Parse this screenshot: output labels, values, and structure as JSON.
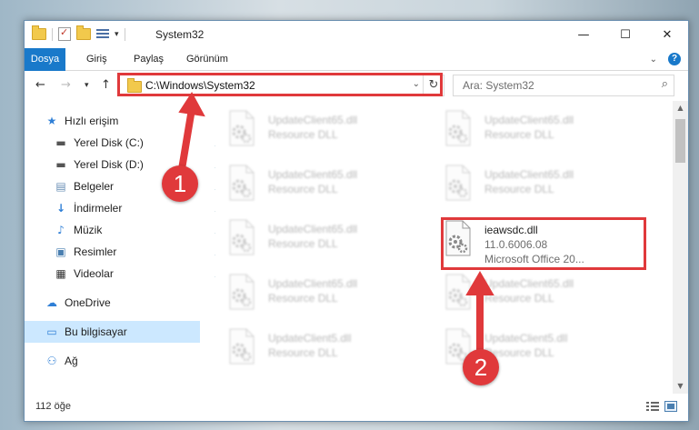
{
  "window": {
    "title": "System32",
    "controls": {
      "minimize": "—",
      "maximize": "☐",
      "close": "✕"
    }
  },
  "ribbon": {
    "tabs": [
      "Dosya",
      "Giriş",
      "Paylaş",
      "Görünüm"
    ]
  },
  "address": {
    "path": "C:\\Windows\\System32",
    "search_placeholder": "Ara: System32"
  },
  "nav": {
    "items": [
      {
        "label": "Hızlı erişim",
        "icon": "star-icon",
        "pinned": false
      },
      {
        "label": "Yerel Disk (C:)",
        "icon": "drive-icon",
        "pinned": true
      },
      {
        "label": "Yerel Disk (D:)",
        "icon": "drive-icon",
        "pinned": true
      },
      {
        "label": "Belgeler",
        "icon": "documents-icon",
        "pinned": true
      },
      {
        "label": "İndirmeler",
        "icon": "download-icon",
        "pinned": true
      },
      {
        "label": "Müzik",
        "icon": "music-icon",
        "pinned": true
      },
      {
        "label": "Resimler",
        "icon": "pictures-icon",
        "pinned": true
      },
      {
        "label": "Videolar",
        "icon": "videos-icon",
        "pinned": true
      },
      {
        "label": "OneDrive",
        "icon": "cloud-icon",
        "pinned": false
      },
      {
        "label": "Bu bilgisayar",
        "icon": "computer-icon",
        "pinned": false,
        "selected": true
      },
      {
        "label": "Ağ",
        "icon": "network-icon",
        "pinned": false
      }
    ]
  },
  "files": {
    "blurred": [
      {
        "name": "UpdateClient65.dll",
        "desc": "Resource DLL"
      },
      {
        "name": "UpdateClient65.dll",
        "desc": "Resource DLL"
      },
      {
        "name": "UpdateClient65.dll",
        "desc": "Resource DLL"
      },
      {
        "name": "UpdateClient65.dll",
        "desc": "Resource DLL"
      },
      {
        "name": "UpdateClient65.dll",
        "desc": "Resource DLL"
      },
      {
        "name": "UpdateClient65.dll",
        "desc": "Resource DLL"
      },
      {
        "name": "UpdateClient65.dll",
        "desc": "Resource DLL"
      },
      {
        "name": "UpdateClient5.dll",
        "desc": "Resource DLL"
      },
      {
        "name": "UpdateClient5.dll",
        "desc": "Resource DLL"
      }
    ],
    "highlighted": {
      "name": "ieawsdc.dll",
      "version": "11.0.6006.08",
      "company": "Microsoft Office 20..."
    }
  },
  "status": {
    "count": "112 öğe"
  },
  "callouts": [
    "1",
    "2"
  ],
  "colors": {
    "accent": "#1979ca",
    "highlight": "#e0393b",
    "selection": "#cce8ff"
  }
}
